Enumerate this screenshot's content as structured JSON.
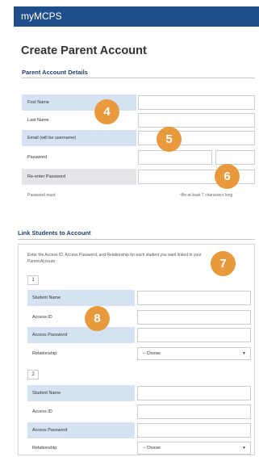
{
  "app": {
    "title": "myMCPS"
  },
  "page": {
    "title": "Create Parent Account"
  },
  "parent_section": {
    "title": "Parent Account Details",
    "fields": [
      {
        "label": "First Name"
      },
      {
        "label": "Last Name"
      },
      {
        "label": "Email (will be username)"
      },
      {
        "label": "Password"
      },
      {
        "label": "Re-enter Password"
      }
    ],
    "password_hint_label": "Password must:",
    "password_hint_rule": "~Be at least 7 characters long"
  },
  "students_section": {
    "title": "Link Students to Account",
    "instructions": "Enter the Access ID, Access Password, and Relationship for each student you want linked to your Parent Account",
    "students": [
      {
        "number": "1",
        "student_name_label": "Student Name",
        "access_id_label": "Access ID",
        "access_password_label": "Access Password",
        "relationship_label": "Relationship",
        "relationship_value": "-- Choose"
      },
      {
        "number": "2",
        "student_name_label": "Student Name",
        "access_id_label": "Access ID",
        "access_password_label": "Access Password",
        "relationship_label": "Relationship",
        "relationship_value": "-- Choose"
      }
    ]
  },
  "callouts": [
    "4",
    "5",
    "6",
    "7",
    "8"
  ],
  "colors": {
    "header_blue": "#1f4e8c",
    "label_shade": "#d4e2f1",
    "callout_orange": "#e89a3c"
  }
}
